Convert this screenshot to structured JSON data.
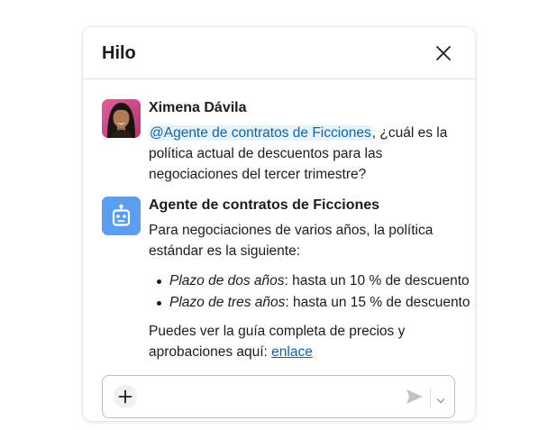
{
  "header": {
    "title": "Hilo",
    "close_icon": "close-icon"
  },
  "messages": [
    {
      "author": "Ximena Dávila",
      "avatar": "user-avatar",
      "mention": "@Agente de contratos de Ficciones",
      "text_after_mention": ", ¿cuál es la política actual de descuentos para las negociaciones del tercer trimestre?"
    },
    {
      "author": "Agente de contratos de Ficciones",
      "avatar": "robot-icon",
      "avatar_color": "#5b9df0",
      "intro": "Para negociaciones de varios años, la política estándar es la siguiente:",
      "bullets": [
        {
          "term": "Plazo de dos años",
          "text": ": hasta un 10 % de descuento"
        },
        {
          "term": "Plazo de tres años",
          "text": ": hasta un 15 % de descuento"
        }
      ],
      "outro": "Puedes ver la guía completa de precios y aprobaciones aquí: ",
      "link_label": "enlace"
    }
  ],
  "composer": {
    "placeholder": "",
    "add_icon": "plus-icon",
    "send_icon": "send-icon",
    "options_icon": "chevron-down-icon"
  },
  "colors": {
    "link": "#1264a3",
    "mention_bg": "#e6f3fb"
  }
}
